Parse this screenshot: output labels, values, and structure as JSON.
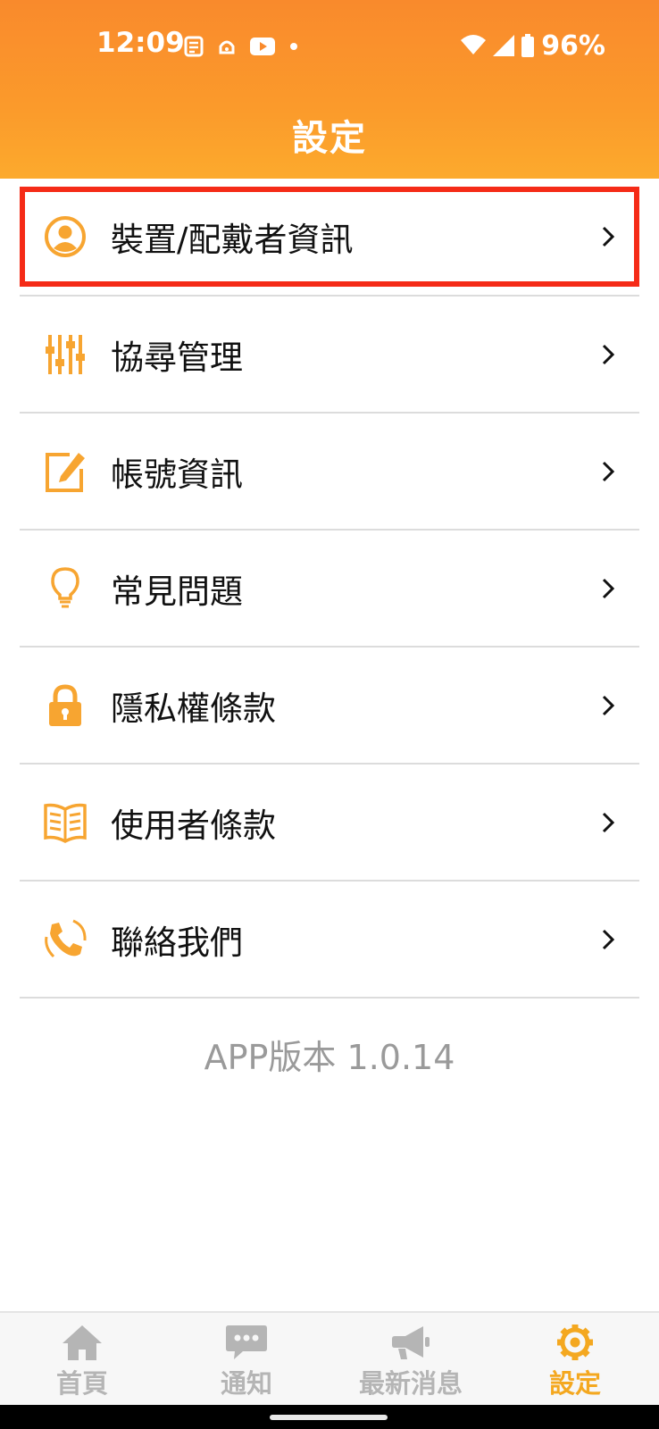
{
  "status_bar": {
    "time": "12:09",
    "battery": "96%",
    "left_icons": [
      "news-icon",
      "app-icon",
      "youtube-icon",
      "dot-icon"
    ],
    "right_icons": [
      "wifi-icon",
      "signal-icon",
      "battery-icon"
    ]
  },
  "header": {
    "title": "設定"
  },
  "menu": {
    "items": [
      {
        "label": "裝置/配戴者資訊",
        "icon": "user-circle-icon",
        "highlighted": true
      },
      {
        "label": "協尋管理",
        "icon": "sliders-icon"
      },
      {
        "label": "帳號資訊",
        "icon": "edit-icon"
      },
      {
        "label": "常見問題",
        "icon": "lightbulb-icon"
      },
      {
        "label": "隱私權條款",
        "icon": "lock-icon"
      },
      {
        "label": "使用者條款",
        "icon": "book-icon"
      },
      {
        "label": "聯絡我們",
        "icon": "phone-icon"
      }
    ]
  },
  "version": "APP版本 1.0.14",
  "tabbar": {
    "tabs": [
      {
        "label": "首頁",
        "icon": "home-icon",
        "active": false
      },
      {
        "label": "通知",
        "icon": "chat-icon",
        "active": false
      },
      {
        "label": "最新消息",
        "icon": "megaphone-icon",
        "active": false
      },
      {
        "label": "設定",
        "icon": "gear-icon",
        "active": true
      }
    ]
  },
  "colors": {
    "header_orange": "#f98a2c",
    "accent_yellow": "#f4a820",
    "icon_orange": "#f7a531",
    "highlight_red": "#f52b17",
    "inactive_gray": "#b5b5b5"
  }
}
